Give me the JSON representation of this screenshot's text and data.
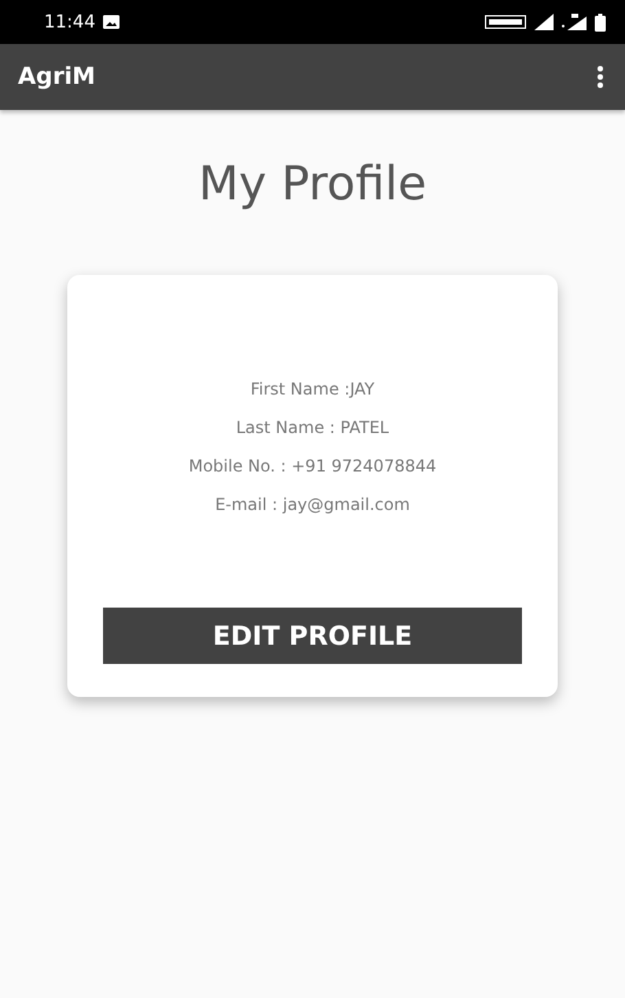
{
  "status_bar": {
    "time": "11:44"
  },
  "app_bar": {
    "title": "AgriM"
  },
  "page_title": "My Profile",
  "profile_lines": [
    "First Name :JAY",
    "Last Name : PATEL",
    "Mobile No. : +91 9724078844",
    "E-mail : jay@gmail.com"
  ],
  "button": "EDIT PROFILE"
}
